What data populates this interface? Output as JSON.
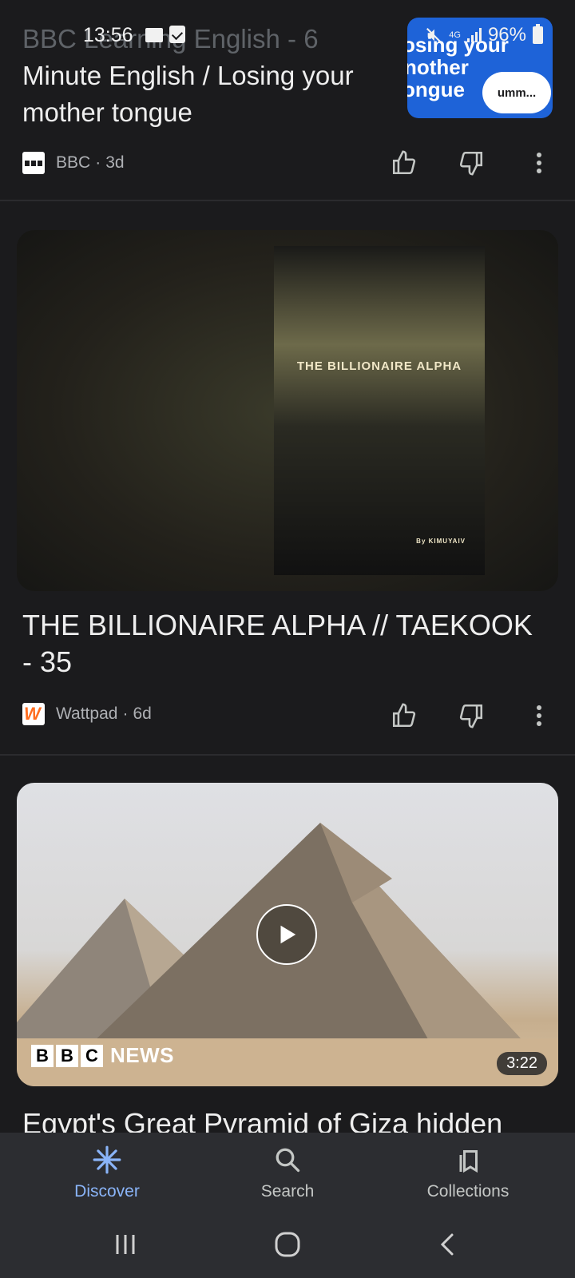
{
  "status_bar": {
    "time": "13:56",
    "network": "4G",
    "battery": "96%"
  },
  "cards": [
    {
      "title_faded": "BBC Learning English - 6",
      "title": "Minute English / Losing your mother tongue",
      "thumb_lines": [
        "osing your",
        "nother",
        "ongue"
      ],
      "thumb_bubble": "umm...",
      "source": "BBC",
      "age": "3d"
    },
    {
      "image_book_title": "THE BILLIONAIRE ALPHA",
      "image_book_author": "By KIMUYAIV",
      "title": "THE BILLIONAIRE ALPHA // TAEKOOK - 35",
      "source": "Wattpad",
      "age": "6d"
    },
    {
      "video_brand": [
        "B",
        "B",
        "C"
      ],
      "video_brand_suffix": "NEWS",
      "duration": "3:22",
      "title": "Egypt's Great Pyramid of Giza hidden"
    }
  ],
  "meta_separator": "·",
  "bottom_nav": [
    {
      "label": "Discover",
      "icon": "discover-icon",
      "active": true
    },
    {
      "label": "Search",
      "icon": "search-icon",
      "active": false
    },
    {
      "label": "Collections",
      "icon": "collections-icon",
      "active": false
    }
  ],
  "colors": {
    "background": "#1b1b1d",
    "accent": "#8ab4f8",
    "nav_bg": "#2c2d31"
  }
}
